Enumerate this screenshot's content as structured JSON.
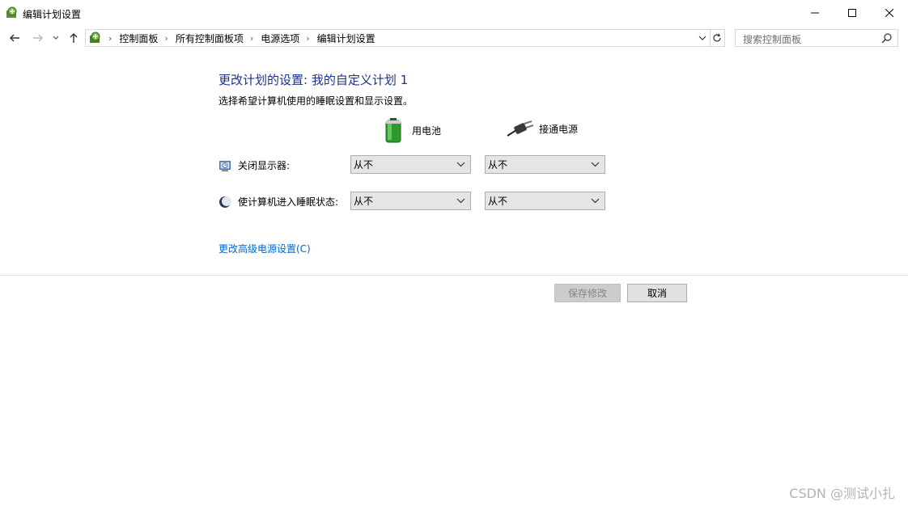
{
  "window": {
    "title": "编辑计划设置",
    "icon": "power-options-icon"
  },
  "nav": {
    "back_icon": "arrow-left-icon",
    "forward_icon": "arrow-right-icon",
    "recent_icon": "chevron-down-icon",
    "up_icon": "arrow-up-icon"
  },
  "breadcrumb": [
    "控制面板",
    "所有控制面板项",
    "电源选项",
    "编辑计划设置"
  ],
  "search": {
    "placeholder": "搜索控制面板"
  },
  "content": {
    "heading": "更改计划的设置: 我的自定义计划 1",
    "subtext": "选择希望计算机使用的睡眠设置和显示设置。",
    "columns": {
      "battery": "用电池",
      "plugged_in": "接通电源"
    },
    "rows": [
      {
        "label": "关闭显示器:",
        "battery_value": "从不",
        "plugged_value": "从不"
      },
      {
        "label": "使计算机进入睡眠状态:",
        "battery_value": "从不",
        "plugged_value": "从不"
      }
    ],
    "advanced_link": "更改高级电源设置(C)"
  },
  "buttons": {
    "save": "保存修改",
    "cancel": "取消"
  },
  "watermark": "CSDN @测试小扎",
  "colors": {
    "heading": "#1e3287",
    "link": "#0066cc"
  }
}
